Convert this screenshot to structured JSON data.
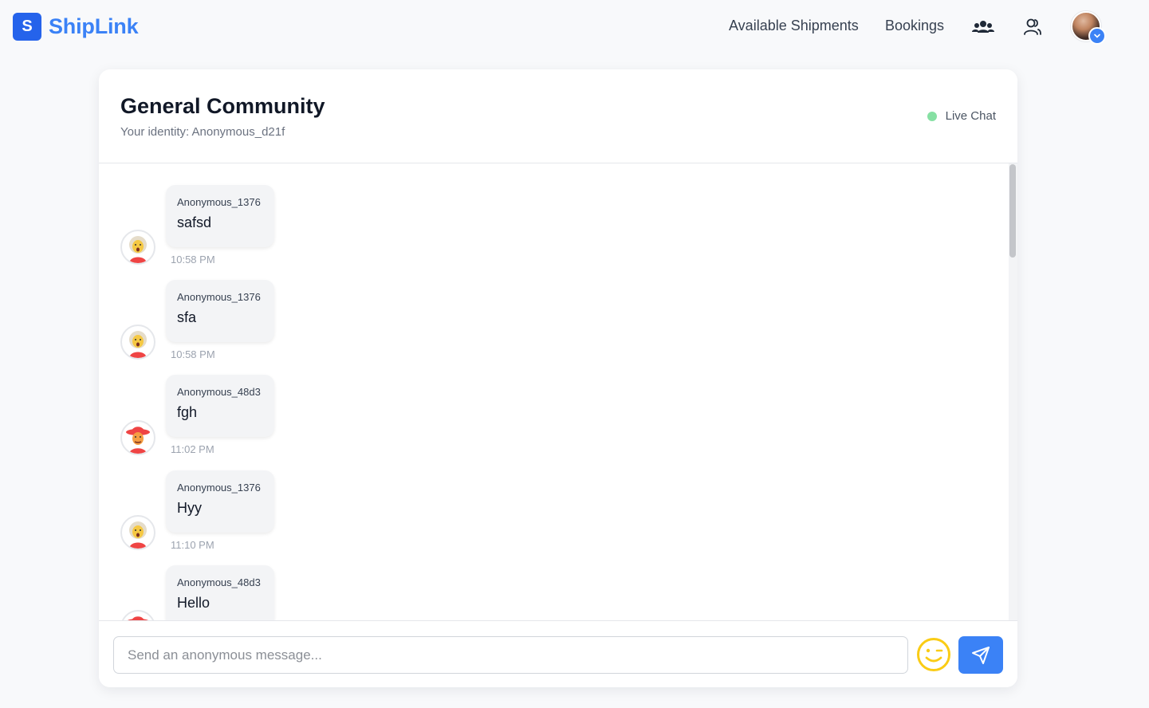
{
  "nav": {
    "brand_letter": "S",
    "brand_name": "ShipLink",
    "links": [
      "Available Shipments",
      "Bookings"
    ],
    "icons": [
      "users-group-icon",
      "user-icon"
    ],
    "accent": "#3b82f6"
  },
  "chat": {
    "title": "General Community",
    "identity": "Your identity: Anonymous_d21f",
    "status": "Live Chat",
    "status_color": "#86e0a3",
    "messages": [
      {
        "sender": "Anonymous_1376",
        "text": "safsd",
        "time": "10:58 PM",
        "avatar": "elder-avatar"
      },
      {
        "sender": "Anonymous_1376",
        "text": "sfa",
        "time": "10:58 PM",
        "avatar": "elder-avatar"
      },
      {
        "sender": "Anonymous_48d3",
        "text": "fgh",
        "time": "11:02 PM",
        "avatar": "hat-avatar"
      },
      {
        "sender": "Anonymous_1376",
        "text": "Hyy",
        "time": "11:10 PM",
        "avatar": "elder-avatar"
      },
      {
        "sender": "Anonymous_48d3",
        "text": "Hello",
        "time": "",
        "avatar": "hat-avatar"
      }
    ]
  },
  "composer": {
    "placeholder": "Send an anonymous message...",
    "value": ""
  }
}
